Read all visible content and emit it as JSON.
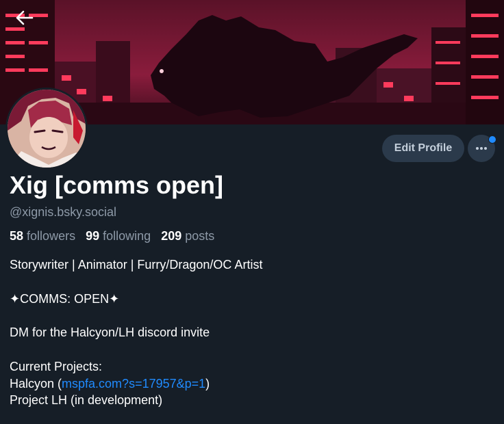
{
  "header": {
    "back_icon": "arrow-left-icon"
  },
  "profile": {
    "display_name": "Xig [comms open]",
    "handle": "@xignis.bsky.social",
    "stats": {
      "followers_count": "58",
      "followers_label": "followers",
      "following_count": "99",
      "following_label": "following",
      "posts_count": "209",
      "posts_label": "posts"
    },
    "actions": {
      "edit_profile_label": "Edit Profile",
      "more_icon": "ellipsis-icon"
    },
    "bio": {
      "line1": "Storywriter | Animator | Furry/Dragon/OC Artist",
      "line2": "✦COMMS: OPEN✦",
      "line3": "DM for the Halcyon/LH discord invite",
      "line4": "Current Projects:",
      "line5_prefix": "Halcyon (",
      "line5_link": "mspfa.com?s=17957&p=1",
      "line5_suffix": ")",
      "line6": "Project LH (in development)"
    }
  },
  "colors": {
    "background": "#161e27",
    "accent": "#208bfe",
    "button_bg": "#2b3a4b",
    "muted_text": "#8e9aa8"
  }
}
